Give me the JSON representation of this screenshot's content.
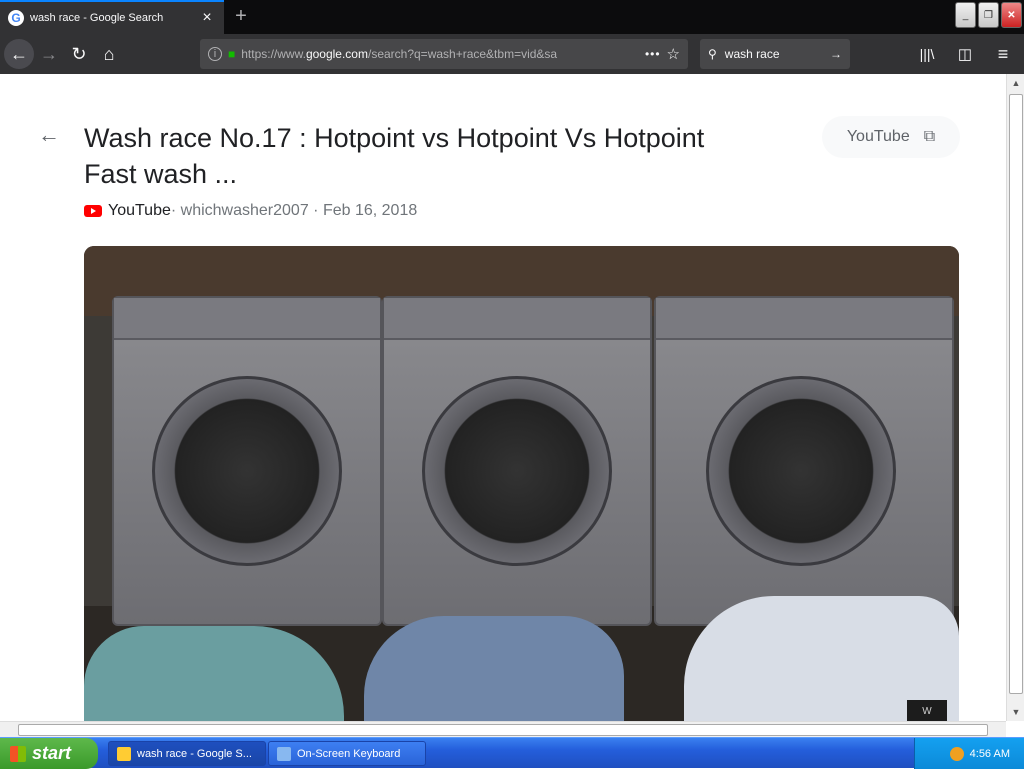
{
  "browser": {
    "tab_title": "wash race - Google Search",
    "tab_favicon": "G",
    "url_prefix": "https://www.",
    "url_domain": "google.com",
    "url_rest": "/search?q=wash+race&tbm=vid&sa",
    "search_query": "wash race"
  },
  "content": {
    "title": "Wash race No.17 : Hotpoint vs Hotpoint Vs Hotpoint Fast wash ...",
    "chip_label": "YouTube",
    "source": "YouTube",
    "meta_rest": " · whichwasher2007 · Feb 16, 2018",
    "watermark": "W"
  },
  "taskbar": {
    "start_label": "start",
    "task1": "wash race - Google S...",
    "task2": "On-Screen Keyboard",
    "time": "4:56 AM"
  },
  "colors": {
    "accent": "#0a84ff",
    "youtube_red": "#ff0000",
    "taskbar_blue": "#245edb"
  }
}
